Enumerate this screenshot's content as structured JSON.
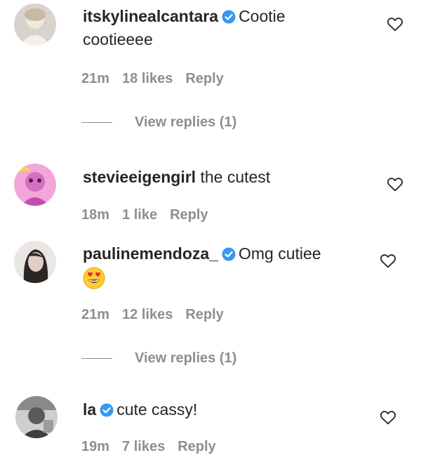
{
  "comments": [
    {
      "username": "itskylinealcantara",
      "verified": true,
      "text_line1": "Cootie",
      "text_line2": "cootieeee",
      "time": "21m",
      "likes": "18 likes",
      "reply": "Reply",
      "view_replies": "View replies (1)"
    },
    {
      "username": "stevieeigengirl",
      "verified": false,
      "text": "the cutest",
      "time": "18m",
      "likes": "1 like",
      "reply": "Reply"
    },
    {
      "username": "paulinemendoza_",
      "verified": true,
      "text": "Omg cutiee",
      "emoji": "heart-eyes-emoji",
      "time": "21m",
      "likes": "12 likes",
      "reply": "Reply",
      "view_replies": "View replies (1)"
    },
    {
      "username": "la",
      "verified": true,
      "text": "cute cassy!",
      "time": "19m",
      "likes": "7 likes",
      "reply": "Reply"
    }
  ],
  "icons": {
    "like": "heart-outline-icon",
    "verified": "verified-badge-icon"
  },
  "colors": {
    "text": "#262626",
    "secondary": "#8e8e8e",
    "verified": "#3897f0"
  }
}
